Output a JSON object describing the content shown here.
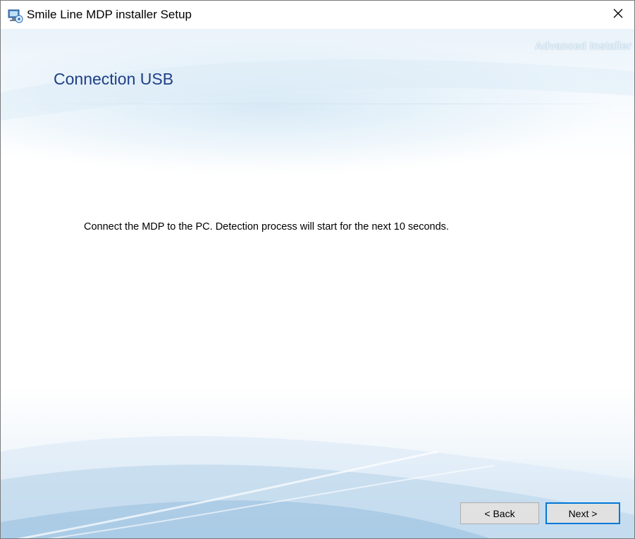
{
  "window": {
    "title": "Smile Line MDP installer Setup",
    "close_glyph": "✕"
  },
  "header": {
    "brand": "Advanced Installer",
    "heading": "Connection USB"
  },
  "body": {
    "message": "Connect the MDP to the PC. Detection process will start for the next 10 seconds."
  },
  "buttons": {
    "back": "< Back",
    "next": "Next >"
  },
  "icons": {
    "app": "installer-computer-icon",
    "close": "close-icon"
  },
  "colors": {
    "heading": "#1f3f87",
    "focus_border": "#0078d7",
    "button_bg": "#e1e1e1"
  }
}
